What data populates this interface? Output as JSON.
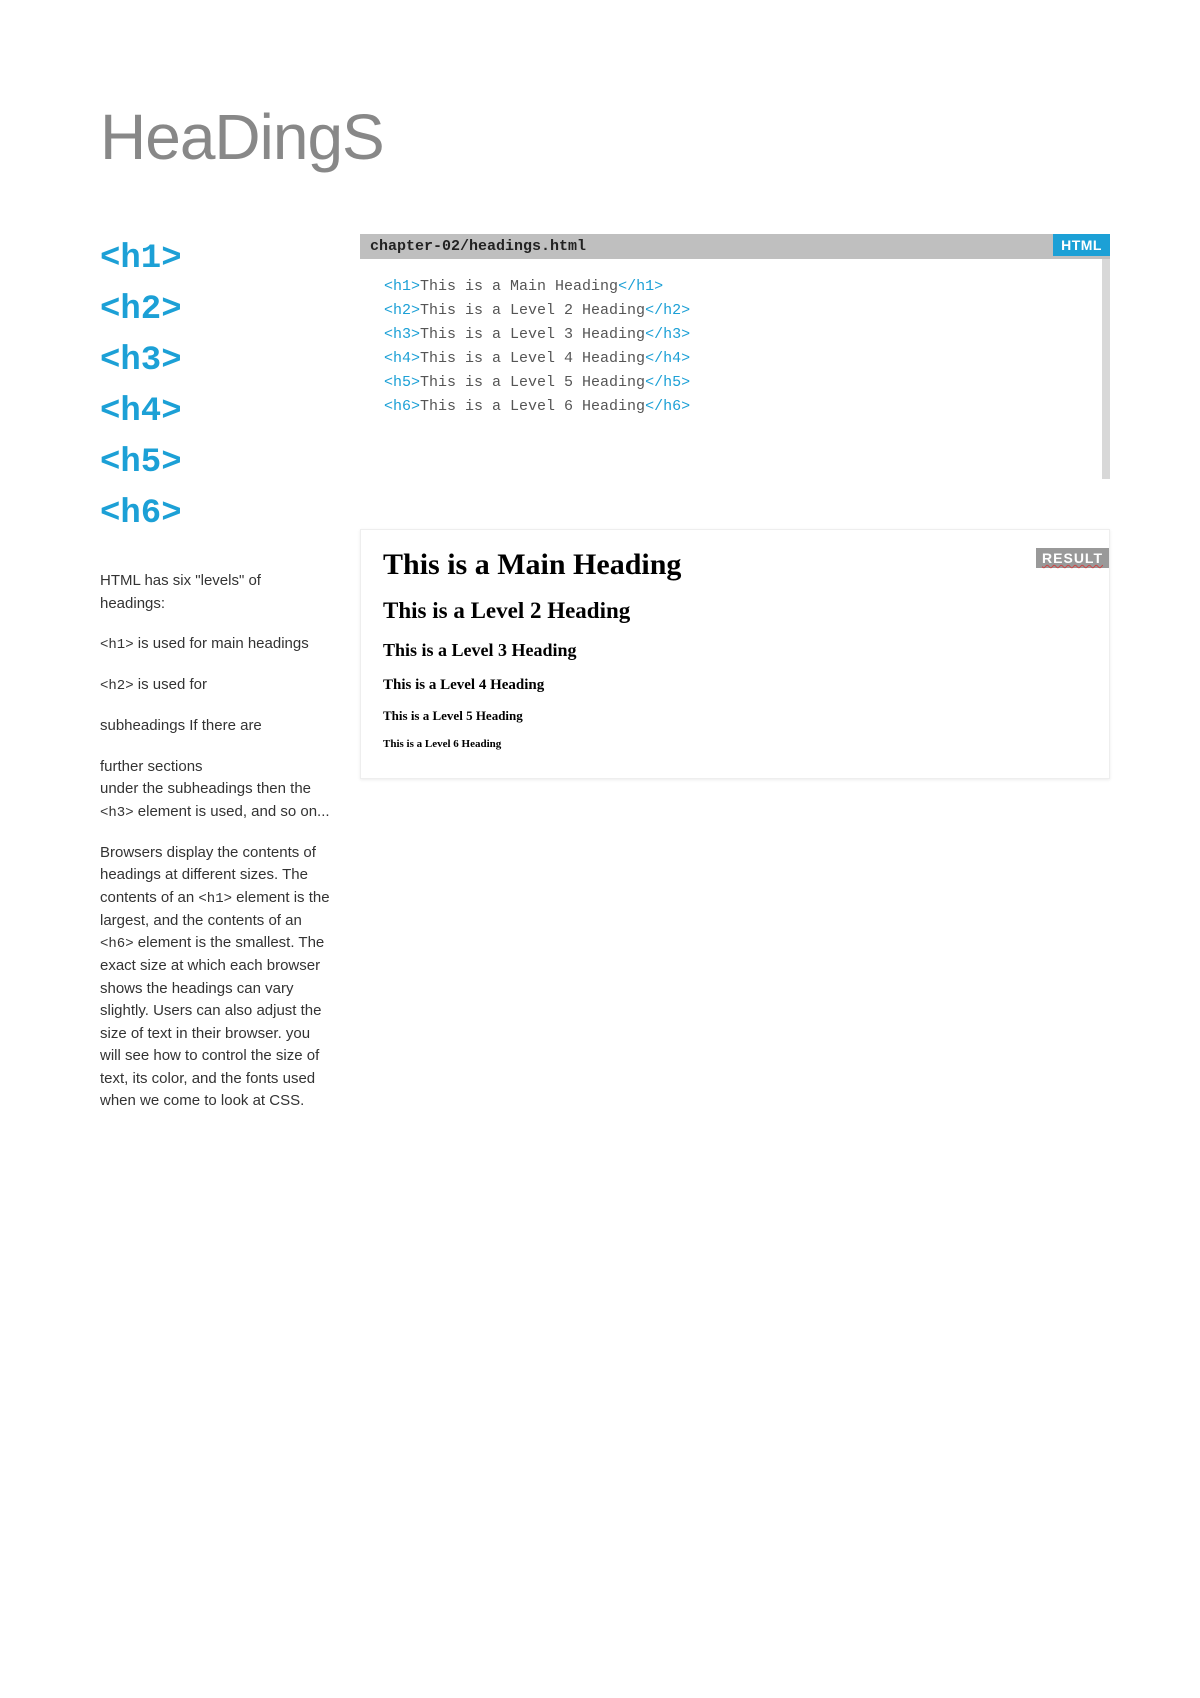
{
  "title": "HeaDingS",
  "tags": {
    "h1": "<h1>",
    "h2": "<h2>",
    "h3": "<h3>",
    "h4": "<h4>",
    "h5": "<h5>",
    "h6": "<h6>"
  },
  "description": {
    "intro": "HTML has six \"levels\" of headings:",
    "p1_before": "",
    "p1_code": "<h1>",
    "p1_after": " is used for main headings",
    "p2_code": "<h2>",
    "p2_after": " is used for",
    "p3": "subheadings If there are",
    "p4_l1": "further sections",
    "p4_l2": "under the subheadings then the",
    "p4_code": "<h3>",
    "p4_l3": " element is used, and so on...",
    "p5_before": "Browsers display the contents of headings at different sizes. The contents of an ",
    "p5_code1": "<h1>",
    "p5_mid": " element is the largest, and the contents of an ",
    "p5_code2": "<h6>",
    "p5_after": " element is the smallest. The exact size at which each browser shows the headings can vary slightly. Users can also adjust the size of text in their browser. you will see how to control the size of text, its color, and the fonts used when we come to look at CSS."
  },
  "code": {
    "filename": "chapter-02/headings.html",
    "label": "HTML",
    "lines": [
      {
        "open": "<h1>",
        "text": "This is a Main Heading",
        "close": "</h1>"
      },
      {
        "open": "<h2>",
        "text": "This is a Level 2 Heading",
        "close": "</h2>"
      },
      {
        "open": "<h3>",
        "text": "This is a Level 3 Heading",
        "close": "</h3>"
      },
      {
        "open": "<h4>",
        "text": "This is a Level 4 Heading",
        "close": "</h4>"
      },
      {
        "open": "<h5>",
        "text": "This is a Level 5 Heading",
        "close": "</h5>"
      },
      {
        "open": "<h6>",
        "text": "This is a Level 6 Heading",
        "close": "</h6>"
      }
    ]
  },
  "result": {
    "label": "RESULT",
    "h1": "This is a Main Heading",
    "h2": "This is a Level 2 Heading",
    "h3": "This is a Level 3 Heading",
    "h4": "This is a Level 4 Heading",
    "h5": "This is a Level 5 Heading",
    "h6": "This is a Level 6 Heading"
  }
}
